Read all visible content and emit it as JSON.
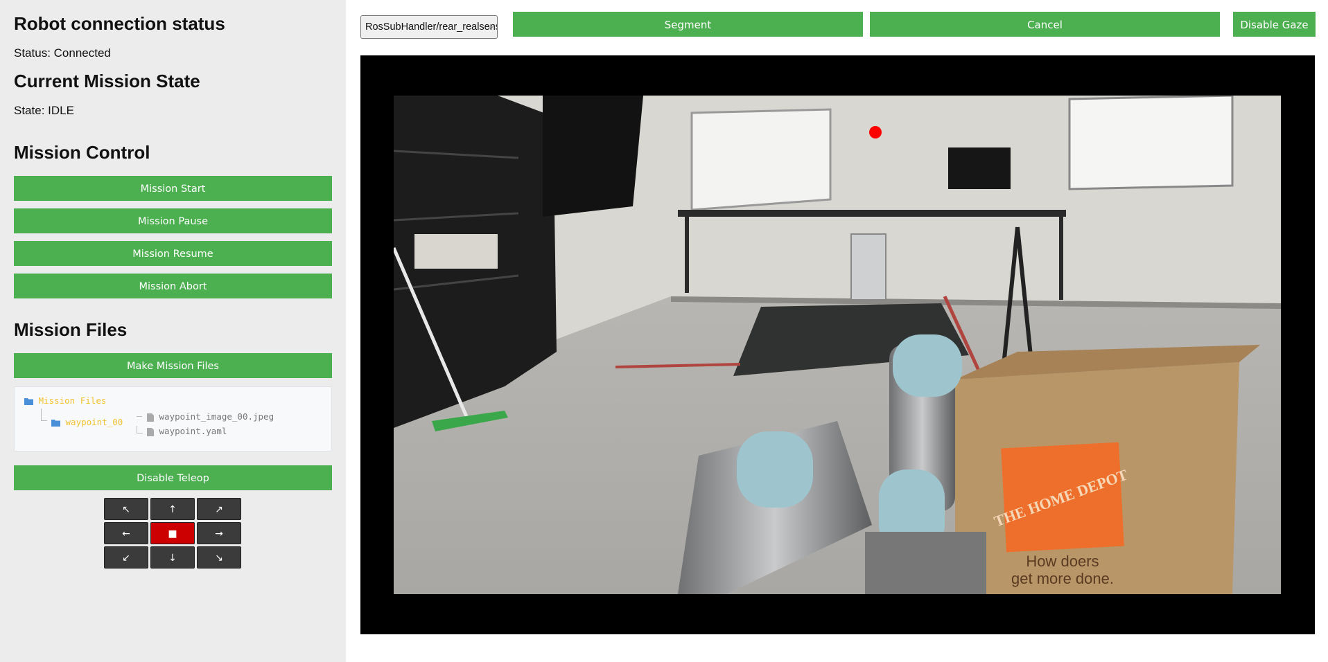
{
  "sidebar": {
    "connection_heading": "Robot connection status",
    "connection_status": "Status: Connected",
    "mission_state_heading": "Current Mission State",
    "mission_state": "State: IDLE",
    "mission_control_heading": "Mission Control",
    "mission_buttons": [
      "Mission Start",
      "Mission Pause",
      "Mission Resume",
      "Mission Abort"
    ],
    "mission_files_heading": "Mission Files",
    "make_files_label": "Make Mission Files",
    "file_tree": {
      "root": "Mission Files",
      "folder": "waypoint_00",
      "files": [
        "waypoint_image_00.jpeg",
        "waypoint.yaml"
      ]
    },
    "teleop_label": "Disable Teleop",
    "dpad": [
      "↖",
      "↑",
      "↗",
      "←",
      "■",
      "→",
      "↙",
      "↓",
      "↘"
    ]
  },
  "toolbar": {
    "topic_selected": "RosSubHandler/rear_realsense",
    "segment_label": "Segment",
    "cancel_label": "Cancel",
    "gaze_label": "Disable Gaze"
  },
  "camera": {
    "box_text_line1": "THE HOME DEPOT",
    "box_text_line2": "How doers",
    "box_text_line3": "get more done.",
    "gaze_marker_color": "#ff0000"
  },
  "colors": {
    "accent_green": "#4caf50",
    "stop_red": "#cc0000",
    "folder_yellow": "#f1c232"
  }
}
